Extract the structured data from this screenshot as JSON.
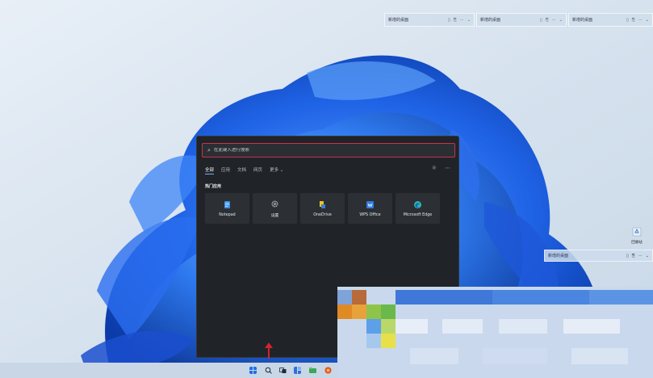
{
  "widgets_top": [
    {
      "title": "新增的桌面",
      "controls": [
        "▯",
        "⎘",
        "⋯",
        "⌄"
      ]
    },
    {
      "title": "新增的桌面",
      "controls": [
        "▯",
        "⎘",
        "⋯",
        "⌄"
      ]
    },
    {
      "title": "新增的桌面",
      "controls": [
        "▯",
        "⎘",
        "⋯",
        "⌄"
      ]
    }
  ],
  "widget_right": {
    "title": "新增的桌面",
    "controls": [
      "▯",
      "⎘",
      "⋯",
      "⌄"
    ]
  },
  "search": {
    "placeholder": "在此键入进行搜索",
    "tabs": [
      "全部",
      "应用",
      "文档",
      "网页",
      "更多 ⌄"
    ],
    "section_title": "热门应用",
    "apps": [
      {
        "label": "Notepad",
        "icon": "notepad-icon",
        "color": "#3a8ee6"
      },
      {
        "label": "设置",
        "icon": "gear-icon",
        "color": "#aab4c0"
      },
      {
        "label": "OneDrive",
        "icon": "onedrive-icon",
        "color": "#f0c419"
      },
      {
        "label": "WPS Office",
        "icon": "wps-icon",
        "color": "#2f7de1"
      },
      {
        "label": "Microsoft Edge",
        "icon": "edge-icon",
        "color": "#2fb5a8"
      }
    ]
  },
  "desktop": {
    "recycle_bin_label": "回收站"
  },
  "colors": {
    "panel_bg": "#202327",
    "tile_bg": "#2c3035",
    "search_highlight": "#c8334a",
    "annotation_arrow": "#d1242e",
    "taskbar_bg": "#c9d6e6"
  }
}
